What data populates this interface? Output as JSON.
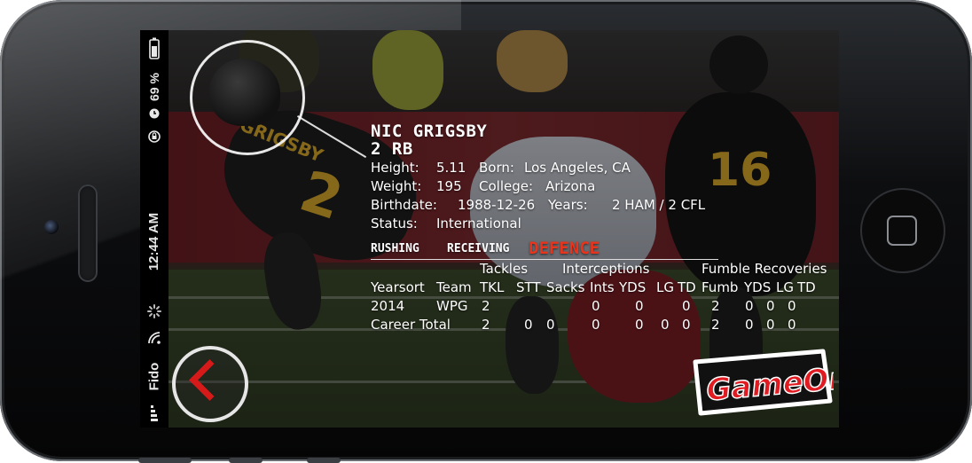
{
  "status_bar": {
    "battery_percent": "69 %",
    "time": "12:44 AM",
    "carrier": "Fido",
    "icons": [
      "battery-icon",
      "alarm-icon",
      "rotation-lock-icon",
      "activity-spinner-icon",
      "wifi-icon",
      "signal-icon"
    ]
  },
  "player": {
    "name": "NIC GRIGSBY",
    "number_pos": "2 RB",
    "height_label": "Height:",
    "height": "5.11",
    "born_label": "Born:",
    "born": "Los Angeles, CA",
    "weight_label": "Weight:",
    "weight": "195",
    "college_label": "College:",
    "college": "Arizona",
    "birthdate_label": "Birthdate:",
    "birthdate": "1988-12-26",
    "years_label": "Years:",
    "years": "2 HAM / 2 CFL",
    "status_label": "Status:",
    "status": "International"
  },
  "tabs": {
    "rushing": "RUSHING",
    "receiving": "RECEIVING",
    "defence": "DEFENCE",
    "active": "defence"
  },
  "table": {
    "groups": {
      "tackles": "Tackles",
      "interceptions": "Interceptions",
      "fumble": "Fumble Recoveries"
    },
    "headers": [
      "Yearsort",
      "Team",
      "TKL",
      "STT",
      "Sacks",
      "Ints",
      "YDS",
      "LG",
      "TD",
      "Fumb",
      "YDS",
      "LG",
      "TD"
    ],
    "rows": [
      [
        "2014",
        "WPG",
        "2",
        "",
        "",
        "0",
        "0",
        "",
        "0",
        "2",
        "0",
        "0",
        "0"
      ],
      [
        "Career Total",
        "",
        "2",
        "0",
        "0",
        "0",
        "0",
        "0",
        "0",
        "2",
        "0",
        "0",
        "0"
      ]
    ]
  },
  "jersey_numbers": {
    "main": "2",
    "background": "16"
  },
  "jersey_name": "GRIGSBY",
  "logo_text": "GameOn",
  "colors": {
    "accent_red": "#e8341c",
    "back_chevron": "#d61a1a",
    "gold": "#d9a82a"
  }
}
